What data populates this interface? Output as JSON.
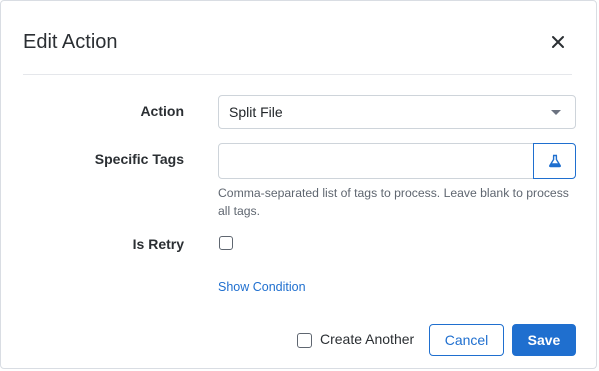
{
  "dialog": {
    "title": "Edit Action",
    "close_icon": "close-icon"
  },
  "form": {
    "action": {
      "label": "Action",
      "value": "Split File"
    },
    "specific_tags": {
      "label": "Specific Tags",
      "value": "",
      "help": "Comma-separated list of tags to process. Leave blank to process all tags.",
      "button_icon": "flask-icon"
    },
    "is_retry": {
      "label": "Is Retry",
      "checked": false
    },
    "show_condition_link": "Show Condition"
  },
  "footer": {
    "create_another": {
      "label": "Create Another",
      "checked": false
    },
    "cancel_label": "Cancel",
    "save_label": "Save"
  },
  "colors": {
    "primary": "#1f6fcf",
    "border": "#ced4da",
    "help_text": "#5f6670"
  }
}
